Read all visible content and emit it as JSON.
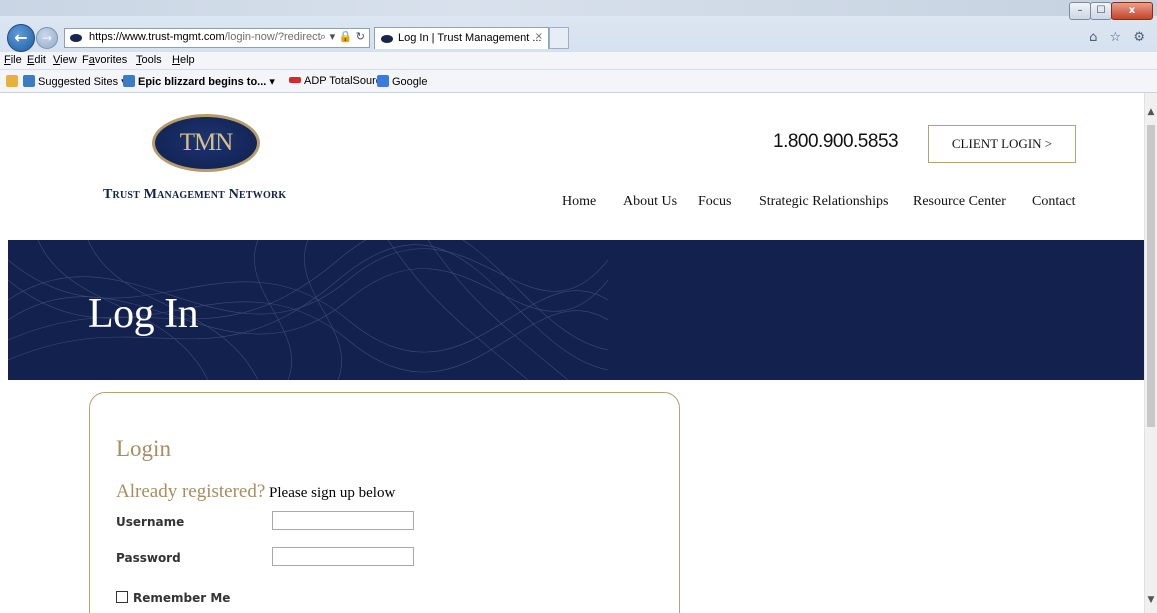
{
  "browser": {
    "url_main": "https://www.trust-mgmt.com",
    "url_rest": "/login-now/?redirect",
    "tab_title": "Log In | Trust Management ...",
    "tab_close": "×",
    "addr_icons": "⌕ ▾ 🔒 ↻",
    "right_icons": "⌂ ☆ ⚙",
    "back": "←",
    "forward": "→"
  },
  "window": {
    "min": "–",
    "max": "☐",
    "close": "x"
  },
  "menu": [
    {
      "acc": "F",
      "rest": "ile"
    },
    {
      "acc": "E",
      "rest": "dit"
    },
    {
      "acc": "V",
      "rest": "iew"
    },
    {
      "pre": "F",
      "acc": "a",
      "rest": "vorites"
    },
    {
      "acc": "T",
      "rest": "ools"
    },
    {
      "acc": "H",
      "rest": "elp"
    }
  ],
  "favorites": {
    "suggested": "Suggested Sites ▾",
    "blizzard": "Epic blizzard begins to...",
    "blizzard_caret": "▾",
    "adp": "ADP TotalSource",
    "google": "Google"
  },
  "site": {
    "logo_initials": "TMN",
    "logo_name": "Trust Management Network",
    "phone": "1.800.900.5853",
    "client_login": "CLIENT LOGIN >",
    "nav": [
      "Home",
      "About Us",
      "Focus",
      "Strategic Relationships",
      "Resource Center",
      "Contact"
    ],
    "banner_title": "Log In"
  },
  "login": {
    "heading": "Login",
    "already": "Already registered?",
    "signup": " Please sign up below",
    "username_label": "Username",
    "password_label": "Password",
    "remember_label": "Remember Me",
    "username_value": "",
    "password_value": ""
  },
  "colors": {
    "navy": "#13214e",
    "gold": "#a88d60",
    "border_gold": "#b89f74"
  }
}
